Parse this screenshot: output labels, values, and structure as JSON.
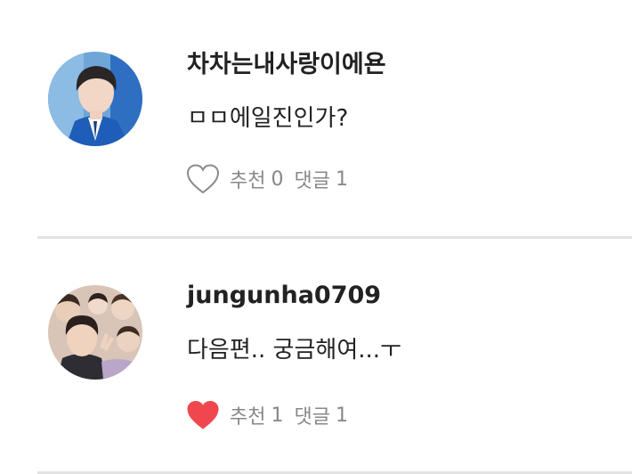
{
  "comments": [
    {
      "author": "차차는내사랑이에욘",
      "text": "ㅁㅁ에일진인가?",
      "like_label": "추천",
      "like_count": "0",
      "reply_label": "댓글",
      "reply_count": "1",
      "liked": false,
      "avatar_icon": "profile-photo-blue-jacket"
    },
    {
      "author": "jungunha0709",
      "text": "다음편.. 궁금해여...ㅜ",
      "like_label": "추천",
      "like_count": "1",
      "reply_label": "댓글",
      "reply_count": "1",
      "liked": true,
      "avatar_icon": "profile-photo-group"
    }
  ],
  "colors": {
    "heart_liked": "#f0474f",
    "heart_outline": "#8a8a8a",
    "divider": "#e2e2e2"
  }
}
